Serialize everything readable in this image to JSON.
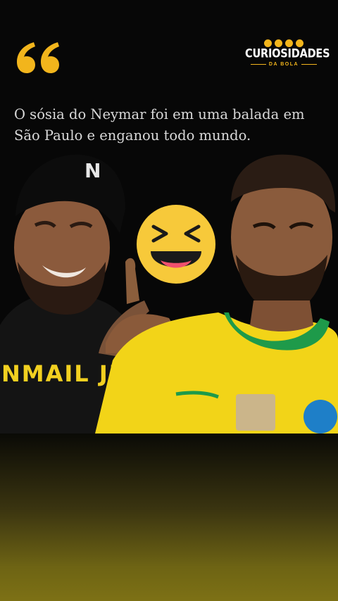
{
  "header": {
    "quote_icon": "left-double-quote-icon",
    "brand": {
      "name": "CURIOSIDADES",
      "subtitle": "DA BOLA",
      "social_icons": [
        "twitter-icon",
        "instagram-icon",
        "youtube-icon",
        "facebook-icon"
      ],
      "accent_color": "#f2b51c"
    }
  },
  "post": {
    "caption": "O sósia do Neymar foi em uma balada em São Paulo e enganou todo mundo."
  },
  "photo": {
    "left_person": {
      "cap_logo": "N",
      "hoodie_text": "NMAIL JR"
    },
    "emoji": "laughing-emoji",
    "right_person": {
      "shirt_color": "#f2d418",
      "collar_color": "#1e9a4a"
    }
  },
  "colors": {
    "background": "#050505",
    "gradient_bottom": "#7d7115"
  }
}
